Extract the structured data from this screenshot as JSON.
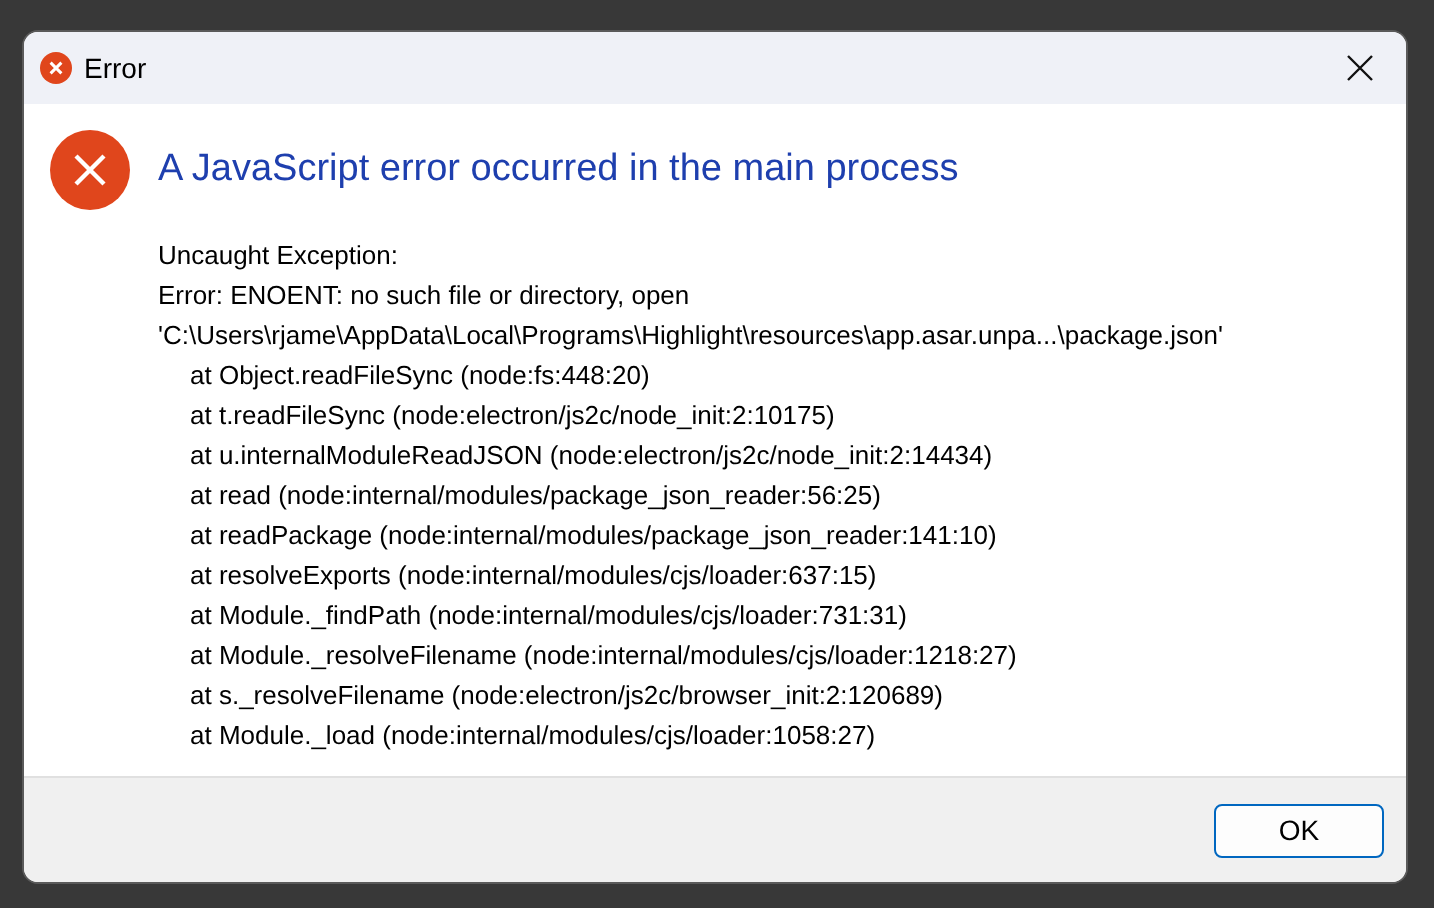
{
  "window": {
    "title": "Error"
  },
  "heading": "A JavaScript error occurred in the main process",
  "message_lines": [
    {
      "kind": "text",
      "text": "Uncaught Exception:"
    },
    {
      "kind": "text",
      "text": "Error: ENOENT: no such file or directory, open"
    },
    {
      "kind": "text",
      "text": "'C:\\Users\\rjame\\AppData\\Local\\Programs\\Highlight\\resources\\app.asar.unpa...\\package.json'"
    },
    {
      "kind": "frame",
      "text": "at Object.readFileSync (node:fs:448:20)"
    },
    {
      "kind": "frame",
      "text": "at t.readFileSync (node:electron/js2c/node_init:2:10175)"
    },
    {
      "kind": "frame",
      "text": "at u.internalModuleReadJSON (node:electron/js2c/node_init:2:14434)"
    },
    {
      "kind": "frame",
      "text": "at read (node:internal/modules/package_json_reader:56:25)"
    },
    {
      "kind": "frame",
      "text": "at readPackage (node:internal/modules/package_json_reader:141:10)"
    },
    {
      "kind": "frame",
      "text": "at resolveExports (node:internal/modules/cjs/loader:637:15)"
    },
    {
      "kind": "frame",
      "text": "at Module._findPath (node:internal/modules/cjs/loader:731:31)"
    },
    {
      "kind": "frame",
      "text": "at Module._resolveFilename (node:internal/modules/cjs/loader:1218:27)"
    },
    {
      "kind": "frame",
      "text": "at s._resolveFilename (node:electron/js2c/browser_init:2:120689)"
    },
    {
      "kind": "frame",
      "text": "at Module._load (node:internal/modules/cjs/loader:1058:27)"
    }
  ],
  "buttons": [
    {
      "label": "OK"
    }
  ]
}
